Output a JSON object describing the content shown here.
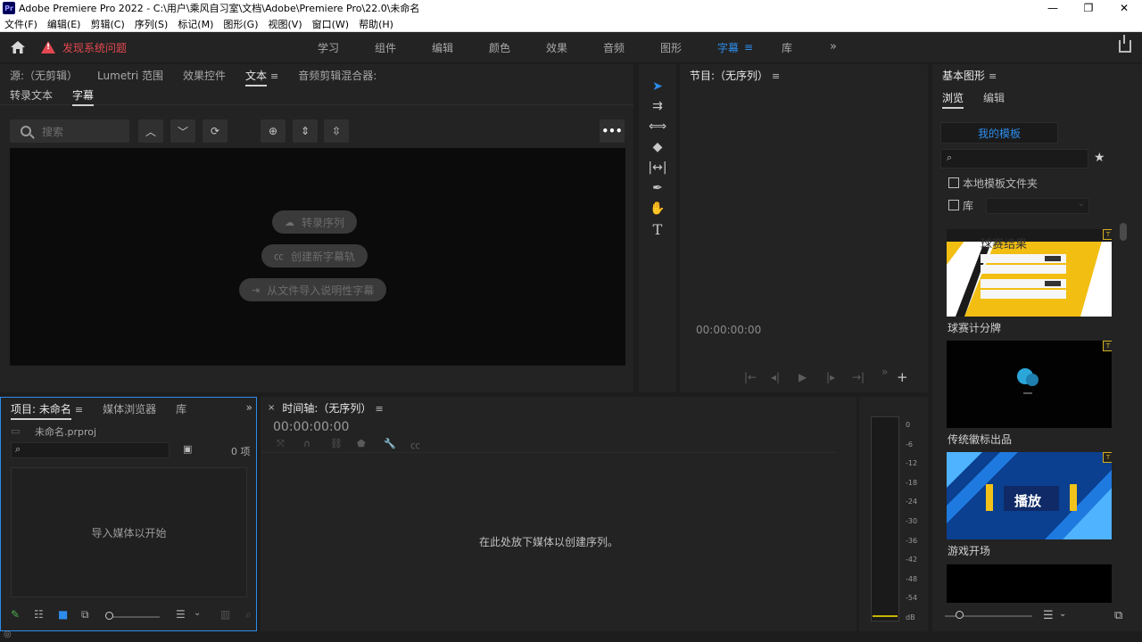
{
  "window": {
    "title": "Adobe Premiere Pro 2022 - C:\\用户\\乘风自习室\\文档\\Adobe\\Premiere Pro\\22.0\\未命名",
    "badge": "Pr",
    "minimize": "—",
    "restore": "❐",
    "close": "✕"
  },
  "menu": [
    "文件(F)",
    "编辑(E)",
    "剪辑(C)",
    "序列(S)",
    "标记(M)",
    "图形(G)",
    "视图(V)",
    "窗口(W)",
    "帮助(H)"
  ],
  "workspace": {
    "warning": "发现系统问题",
    "tabs": [
      "学习",
      "组件",
      "编辑",
      "颜色",
      "效果",
      "音频",
      "图形",
      "字幕",
      "库"
    ],
    "active_tab": "字幕",
    "more": "»"
  },
  "source_panel": {
    "tabs": [
      "源:（无剪辑）",
      "Lumetri 范围",
      "效果控件",
      "文本",
      "音频剪辑混合器:"
    ],
    "active_tab": "文本",
    "subtabs": [
      "转录文本",
      "字幕"
    ],
    "active_subtab": "字幕",
    "search_placeholder": "搜索",
    "stage_buttons": [
      "转录序列",
      "创建新字幕轨",
      "从文件导入说明性字幕"
    ]
  },
  "program_panel": {
    "title": "节目:（无序列）",
    "timecode": "00:00:00:00"
  },
  "essential_graphics": {
    "title": "基本图形",
    "subtabs": [
      "浏览",
      "编辑"
    ],
    "active_subtab": "浏览",
    "my_templates": "我的模板",
    "local_folder": "本地模板文件夹",
    "library": "库",
    "templates": [
      {
        "label": "球赛计分牌",
        "thumb_text": "球赛结果"
      },
      {
        "label": "传统徽标出品",
        "thumb_text": ""
      },
      {
        "label": "游戏开场",
        "thumb_text": "播放"
      }
    ]
  },
  "project_panel": {
    "tabs": [
      "项目: 未命名",
      "媒体浏览器",
      "库"
    ],
    "active_tab": "项目: 未命名",
    "file": "未命名.prproj",
    "count": "0 项",
    "empty_text": "导入媒体以开始"
  },
  "timeline_panel": {
    "title": "时间轴:（无序列）",
    "timecode": "00:00:00:00",
    "empty_text": "在此处放下媒体以创建序列。"
  },
  "audio_meter": {
    "labels": [
      "0",
      "-6",
      "-12",
      "-18",
      "-24",
      "-30",
      "-36",
      "-42",
      "-48",
      "-54",
      "dB"
    ]
  },
  "colors": {
    "accent": "#2d8ceb",
    "warning": "#e34850",
    "badge": "#d4b21f"
  }
}
